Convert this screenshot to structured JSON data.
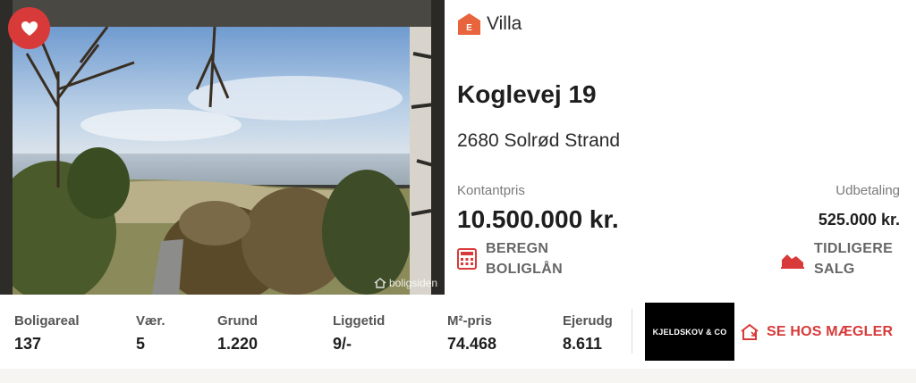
{
  "listing": {
    "type": "Villa",
    "type_badge": "E",
    "address": "Koglevej 19",
    "city": "2680 Solrød Strand",
    "price_label": "Kontantpris",
    "price_value": "10.500.000 kr.",
    "down_label": "Udbetaling",
    "down_value": "525.000 kr.",
    "watermark": "boligsiden"
  },
  "actions": {
    "calc_line1": "BEREGN",
    "calc_line2": "BOLIGLÅN",
    "sales_line1": "TIDLIGERE",
    "sales_line2": "SALG",
    "favorite_icon": "heart-icon"
  },
  "stats": [
    {
      "label": "Boligareal",
      "value": "137"
    },
    {
      "label": "Vær.",
      "value": "5"
    },
    {
      "label": "Grund",
      "value": "1.220"
    },
    {
      "label": "Liggetid",
      "value": "9/-"
    },
    {
      "label": "M²-pris",
      "value": "74.468"
    },
    {
      "label": "Ejerudg",
      "value": "8.611"
    }
  ],
  "agent": {
    "logo_text": "KJELDSKOV & CO",
    "button_label": "SE HOS MÆGLER"
  },
  "colors": {
    "accent": "#d83a3a",
    "energy_badge": "#e8643c"
  }
}
